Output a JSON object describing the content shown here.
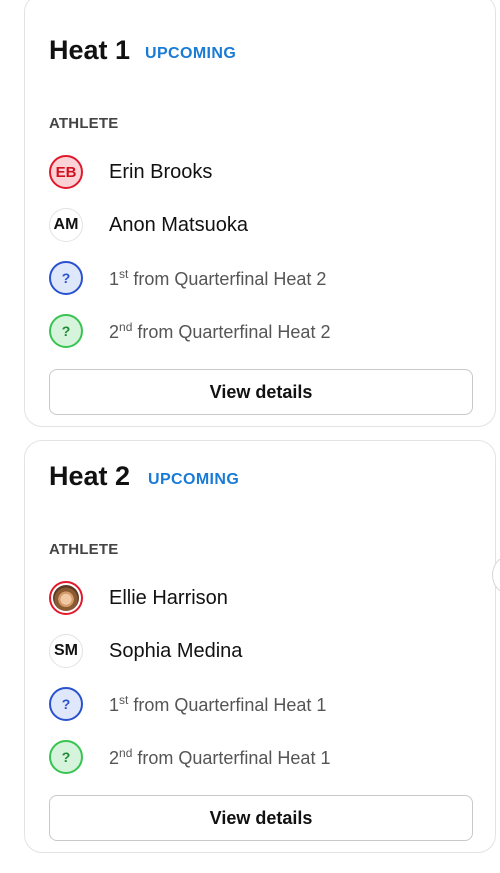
{
  "heats": [
    {
      "title": "Heat 1",
      "status": "UPCOMING",
      "athlete_header": "ATHLETE",
      "athletes": [
        {
          "initials": "EB",
          "name": "Erin Brooks",
          "style": "red"
        },
        {
          "initials": "AM",
          "name": "Anon Matsuoka",
          "style": "white"
        }
      ],
      "seeds": [
        {
          "icon": "?",
          "ordinal": "1",
          "suffix": "st",
          "text": " from Quarterfinal Heat 2",
          "style": "blue"
        },
        {
          "icon": "?",
          "ordinal": "2",
          "suffix": "nd",
          "text": " from Quarterfinal Heat 2",
          "style": "green"
        }
      ],
      "button_label": "View details"
    },
    {
      "title": "Heat 2",
      "status": "UPCOMING",
      "athlete_header": "ATHLETE",
      "athletes": [
        {
          "initials": "",
          "name": "Ellie Harrison",
          "style": "photo"
        },
        {
          "initials": "SM",
          "name": "Sophia Medina",
          "style": "white"
        }
      ],
      "seeds": [
        {
          "icon": "?",
          "ordinal": "1",
          "suffix": "st",
          "text": " from Quarterfinal Heat 1",
          "style": "blue"
        },
        {
          "icon": "?",
          "ordinal": "2",
          "suffix": "nd",
          "text": " from Quarterfinal Heat 1",
          "style": "green"
        }
      ],
      "button_label": "View details"
    }
  ],
  "colors": {
    "status_blue": "#1a7bd6",
    "red_accent": "#e01a2c",
    "seed_blue": "#2a52cf",
    "seed_green": "#38c452"
  }
}
